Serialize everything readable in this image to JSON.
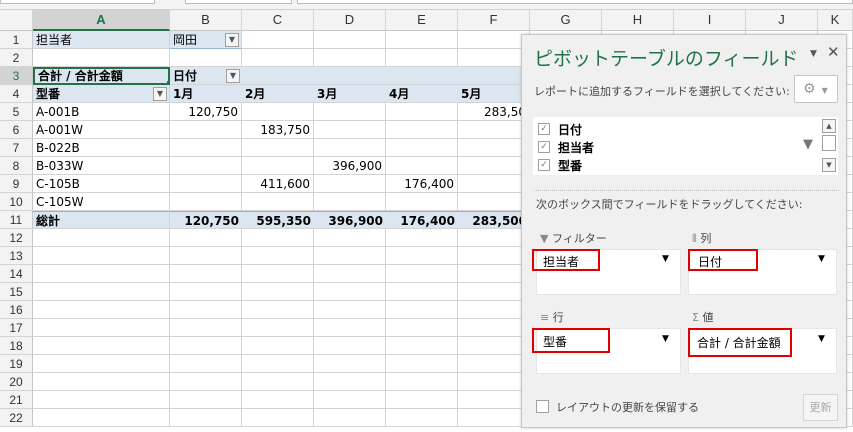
{
  "columns": [
    "A",
    "B",
    "C",
    "D",
    "E",
    "F",
    "G",
    "H",
    "I",
    "J",
    "K"
  ],
  "rows": [
    "1",
    "2",
    "3",
    "4",
    "5",
    "6",
    "7",
    "8",
    "9",
    "10",
    "11",
    "12",
    "13",
    "14",
    "15",
    "16",
    "17",
    "18",
    "19",
    "20",
    "21",
    "22"
  ],
  "pivot": {
    "filter_label": "担当者",
    "filter_value": "岡田",
    "values_label": "合計 / 合計金額",
    "col_field": "日付",
    "row_field": "型番",
    "months": [
      "1月",
      "2月",
      "3月",
      "4月",
      "5月"
    ],
    "data": [
      {
        "item": "A-001B",
        "values": [
          "120,750",
          "",
          "",
          "",
          "283,50"
        ]
      },
      {
        "item": "A-001W",
        "values": [
          "",
          "183,750",
          "",
          "",
          ""
        ]
      },
      {
        "item": "B-022B",
        "values": [
          "",
          "",
          "",
          "",
          ""
        ]
      },
      {
        "item": "B-033W",
        "values": [
          "",
          "",
          "396,900",
          "",
          ""
        ]
      },
      {
        "item": "C-105B",
        "values": [
          "",
          "411,600",
          "",
          "176,400",
          ""
        ]
      },
      {
        "item": "C-105W",
        "values": [
          "",
          "",
          "",
          "",
          ""
        ]
      }
    ],
    "total_label": "総計",
    "totals": [
      "120,750",
      "595,350",
      "396,900",
      "176,400",
      "283,500"
    ]
  },
  "panel": {
    "title": "ピボットテーブルのフィールド",
    "choose_text": "レポートに追加するフィールドを選択してください:",
    "fields": [
      {
        "name": "日付",
        "checked": true
      },
      {
        "name": "担当者",
        "checked": true
      },
      {
        "name": "型番",
        "checked": true
      }
    ],
    "drag_text": "次のボックス間でフィールドをドラッグしてください:",
    "areas": {
      "filter": {
        "label": "フィルター",
        "item": "担当者"
      },
      "columns": {
        "label": "列",
        "item": "日付"
      },
      "rows": {
        "label": "行",
        "item": "型番"
      },
      "values": {
        "label": "値",
        "item": "合計 / 合計金額"
      }
    },
    "defer_label": "レイアウトの更新を保留する",
    "update_label": "更新"
  },
  "colors": {
    "accent": "#217346",
    "pivot_header": "#dce6f1",
    "highlight": "#e00000"
  }
}
